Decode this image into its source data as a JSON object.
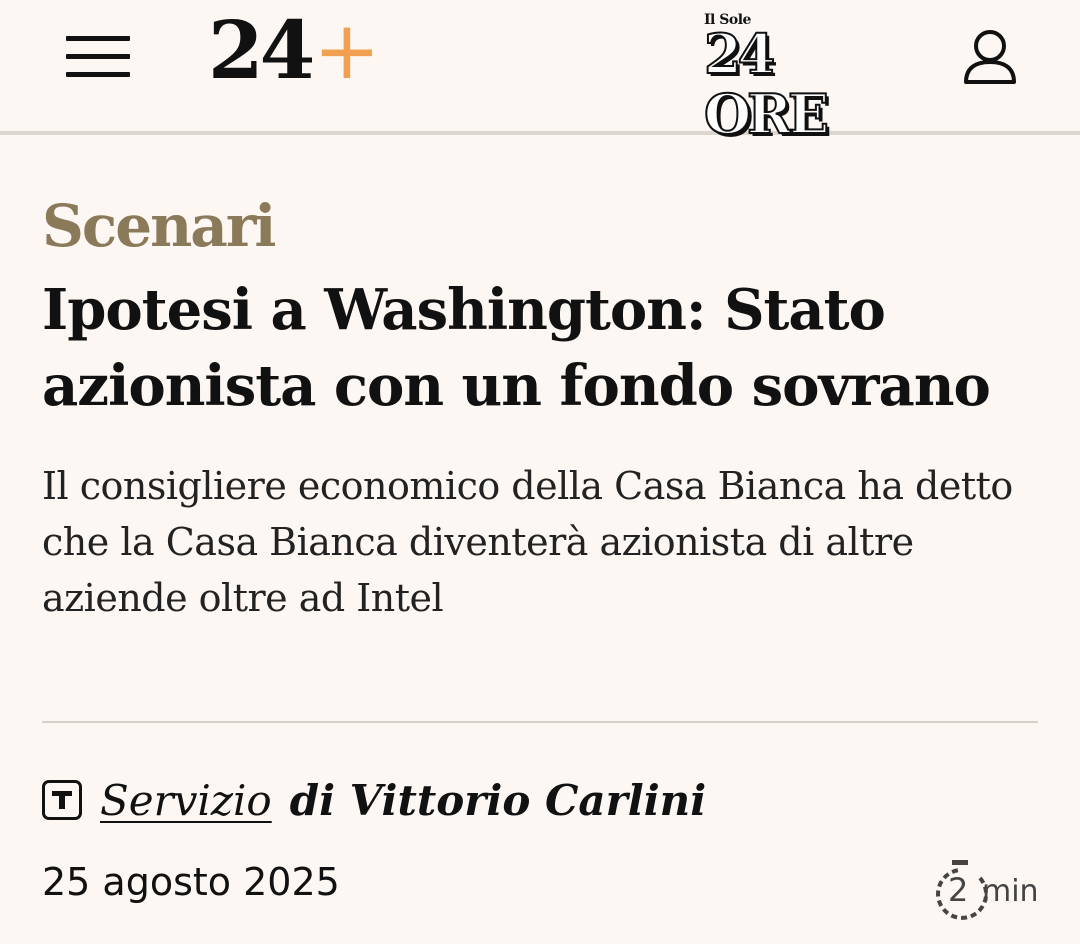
{
  "header": {
    "brand_number": "24",
    "brand_plus": "+",
    "publisher_small": "Il Sole",
    "publisher_big": "24 ORE",
    "accent_color": "#f0a050"
  },
  "article": {
    "category": "Scenari",
    "category_color": "#8b7a5a",
    "headline": "Ipotesi a Washington: Stato azionista con un fondo sovrano",
    "subtitle": "Il consigliere economico della Casa Bianca ha detto che la Casa Bianca diventerà azionista di altre aziende oltre ad Intel",
    "byline_type": "Servizio",
    "byline_author": "di Vittorio Carlini",
    "date": "25 agosto 2025",
    "read_time_value": "2",
    "read_time_unit": "min"
  },
  "icons": {
    "menu": "hamburger-menu-icon",
    "user": "user-icon",
    "article_type": "t-badge-icon",
    "read_time": "stopwatch-icon"
  }
}
